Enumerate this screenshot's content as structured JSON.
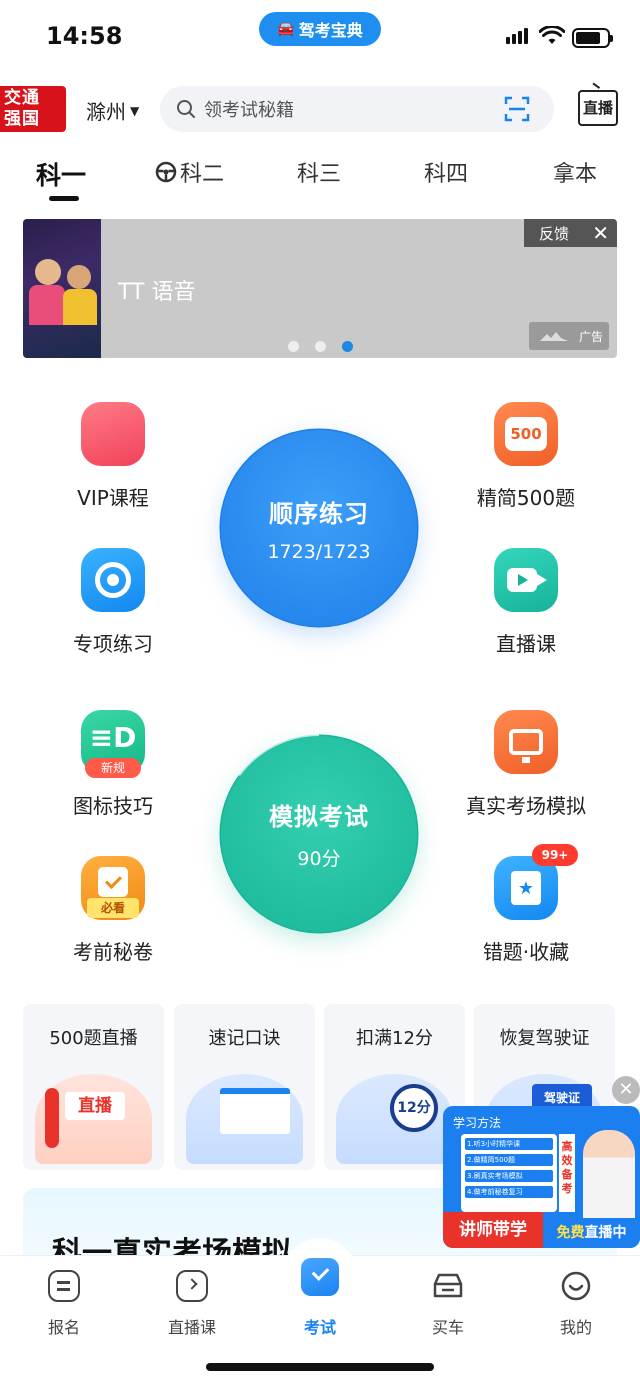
{
  "status_bar": {
    "time": "14:58",
    "app_name": "驾考宝典"
  },
  "header": {
    "badge_line1": "交通",
    "badge_line2": "强国",
    "city": "滁州",
    "search_placeholder": "领考试秘籍",
    "live_label": "直播"
  },
  "tabs": [
    {
      "label": "科一",
      "active": true
    },
    {
      "label": "科二",
      "icon": "steering-wheel-icon"
    },
    {
      "label": "科三"
    },
    {
      "label": "科四"
    },
    {
      "label": "拿本"
    }
  ],
  "banner": {
    "title": "TT 语音",
    "feedback": "反馈",
    "close": "✕",
    "ad_label": "广告",
    "page_count": 3,
    "active_page": 3
  },
  "grid_top": {
    "left": [
      {
        "label": "VIP课程",
        "icon": "vip-icon"
      },
      {
        "label": "专项练习",
        "icon": "target-icon"
      }
    ],
    "right": [
      {
        "label": "精简500题",
        "icon": "500-icon",
        "icon_text": "500"
      },
      {
        "label": "直播课",
        "icon": "video-camera-icon"
      }
    ],
    "circle": {
      "title": "顺序练习",
      "progress_text": "1723/1723",
      "done": 1723,
      "total": 1723
    }
  },
  "grid_bottom": {
    "left": [
      {
        "label": "图标技巧",
        "icon": "sign-icon",
        "tag": "新规"
      },
      {
        "label": "考前秘卷",
        "icon": "exam-paper-icon",
        "tag": "必看"
      }
    ],
    "right": [
      {
        "label": "真实考场模拟",
        "icon": "monitor-icon"
      },
      {
        "label": "错题·收藏",
        "icon": "bookmark-star-icon",
        "badge": "99+"
      }
    ],
    "circle": {
      "title": "模拟考试",
      "subtitle": "90分"
    }
  },
  "cards": [
    {
      "title": "500题直播",
      "ill_text": "直播"
    },
    {
      "title": "速记口诀"
    },
    {
      "title": "扣满12分",
      "ill_text": "12分"
    },
    {
      "title": "恢复驾驶证",
      "ill_text": "驾驶证"
    }
  ],
  "section": {
    "title": "科一真实考场模拟"
  },
  "float_ad": {
    "header": "学习方法",
    "items": [
      "1.听3小时精华课",
      "2.做精简500题",
      "3.刷真实考场模拟",
      "4.做考前秘卷复习"
    ],
    "side_text": "高效备考",
    "bottom_left": "讲师带学",
    "bottom_right_1": "免费",
    "bottom_right_2": "直播中",
    "close": "✕"
  },
  "nav": [
    {
      "label": "报名",
      "icon": "form-icon"
    },
    {
      "label": "直播课",
      "icon": "tv-icon"
    },
    {
      "label": "考试",
      "icon": "exam-check-icon",
      "active": true
    },
    {
      "label": "买车",
      "icon": "car-icon"
    },
    {
      "label": "我的",
      "icon": "smile-icon"
    }
  ],
  "colors": {
    "primary_blue": "#1a83f2",
    "exam_green": "#18b697",
    "danger_red": "#e9322a"
  }
}
